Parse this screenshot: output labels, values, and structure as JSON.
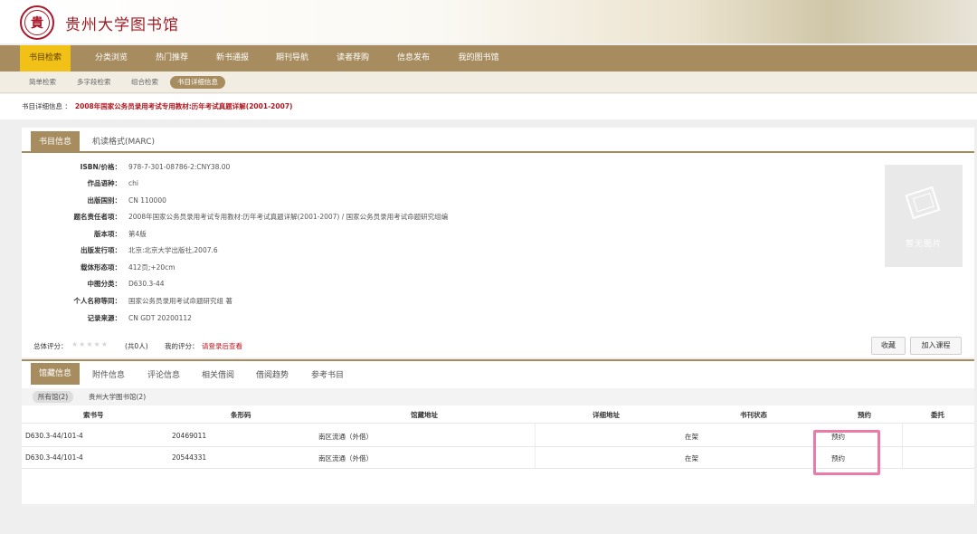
{
  "header": {
    "logo_char": "貴",
    "site_title": "贵州大学图书馆"
  },
  "nav": {
    "items": [
      "书目检索",
      "分类浏览",
      "热门推荐",
      "新书通报",
      "期刊导航",
      "读者荐购",
      "信息发布",
      "我的图书馆"
    ]
  },
  "subnav": {
    "items": [
      "简单检索",
      "多字段检索",
      "组合检索",
      "书目详细信息"
    ]
  },
  "breadcrumb": {
    "label": "书目详细信息 ：",
    "title": "2008年国家公务员录用考试专用教材:历年考试真题详解(2001-2007)"
  },
  "detail": {
    "tabs": [
      "书目信息",
      "机读格式(MARC)"
    ],
    "fields": [
      {
        "label": "ISBN/价格：",
        "value": "978-7-301-08786-2:CNY38.00"
      },
      {
        "label": "作品语种：",
        "value": "chi"
      },
      {
        "label": "出版国别：",
        "value": "CN 110000"
      },
      {
        "label": "题名责任者项：",
        "value": "2008年国家公务员录用考试专用教材:历年考试真题详解(2001-2007) / 国家公务员录用考试命题研究组编"
      },
      {
        "label": "版本项：",
        "value": "第4版"
      },
      {
        "label": "出版发行项：",
        "value": "北京:北京大学出版社,2007.6"
      },
      {
        "label": "载体形态项：",
        "value": "412页;+20cm"
      },
      {
        "label": "中图分类：",
        "value": "D630.3-44"
      },
      {
        "label": "个人名称等同：",
        "value": "国家公务员录用考试命题研究组 著"
      },
      {
        "label": "记录来源：",
        "value": "CN GDT 20200112"
      }
    ],
    "no_image": "暂无图片",
    "rating_label": "总体评分：",
    "stars": "★★★★★",
    "rating_count": "(共0人)",
    "my_rating_label": "我的评分：",
    "login_link": "请登录后查看",
    "collect_button": "收藏",
    "add_course_button": "加入课程"
  },
  "holdings": {
    "tabs": [
      "馆藏信息",
      "附件信息",
      "评论信息",
      "相关借阅",
      "借阅趋势",
      "参考书目"
    ],
    "filters": [
      "所有馆(2)",
      "贵州大学图书馆(2)"
    ],
    "columns": [
      "索书号",
      "条形码",
      "馆藏地址",
      "详细地址",
      "书刊状态",
      "预约",
      "委托"
    ],
    "rows": [
      {
        "call_number": "D630.3-44/101-4",
        "barcode": "20469011",
        "location": "南区流通（外借）",
        "detail": "",
        "status": "在架",
        "reserve": "预约",
        "entrust": ""
      },
      {
        "call_number": "D630.3-44/101-4",
        "barcode": "20544331",
        "location": "南区流通（外借）",
        "detail": "",
        "status": "在架",
        "reserve": "预约",
        "entrust": ""
      }
    ]
  },
  "colors": {
    "brand": "#a68c5f",
    "active_nav": "#f1c117",
    "title_red": "#b0171f",
    "highlight": "#ec7aa8"
  }
}
